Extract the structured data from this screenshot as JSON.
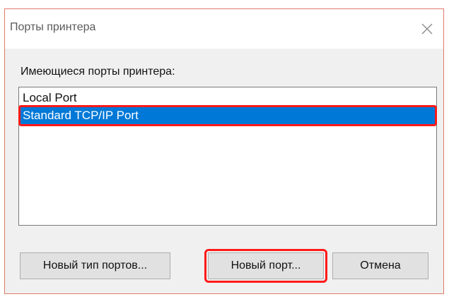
{
  "background_tabs": [
    "",
    "",
    "",
    ""
  ],
  "dialog": {
    "title": "Порты принтера",
    "close_icon": "close-icon",
    "ports_label": "Имеющиеся порты принтера:",
    "ports": [
      {
        "name": "Local Port",
        "selected": false
      },
      {
        "name": "Standard TCP/IP Port",
        "selected": true
      }
    ],
    "buttons": {
      "new_port_type": "Новый тип портов...",
      "new_port": "Новый порт...",
      "cancel": "Отмена"
    }
  },
  "colors": {
    "selection": "#0078d7",
    "highlight_frame": "#ff1a1a",
    "dialog_background": "#f0f0f0"
  }
}
